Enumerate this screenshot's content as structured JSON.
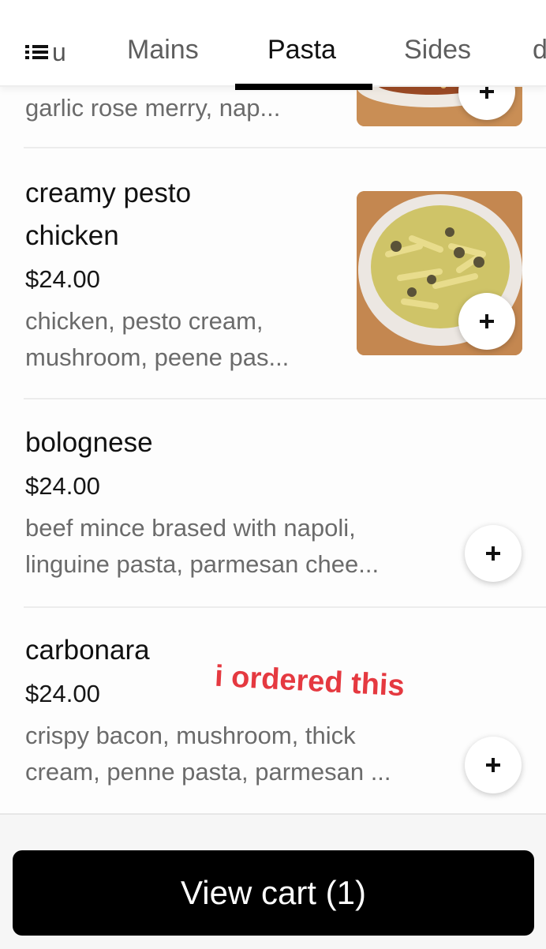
{
  "tabs": {
    "menu_label": "u",
    "items": [
      "Mains",
      "Pasta",
      "Sides",
      "d"
    ],
    "active": "Pasta"
  },
  "items": [
    {
      "desc": "garlic rose merry, nap..."
    },
    {
      "name": "creamy pesto\nchicken",
      "price": "$24.00",
      "desc": "chicken, pesto cream,\nmushroom, peene pas..."
    },
    {
      "name": "bolognese",
      "price": "$24.00",
      "desc": "beef mince brased with napoli,\nlinguine pasta, parmesan chee..."
    },
    {
      "name": "carbonara",
      "price": "$24.00",
      "desc": "crispy bacon, mushroom, thick\ncream, penne pasta, parmesan ..."
    }
  ],
  "annotation": "i ordered this",
  "cart": {
    "label": "View cart (1)",
    "count": 1
  },
  "icons": [
    "list-icon",
    "plus-icon"
  ],
  "colors": {
    "accent": "#000000",
    "annotation": "#e53940"
  }
}
